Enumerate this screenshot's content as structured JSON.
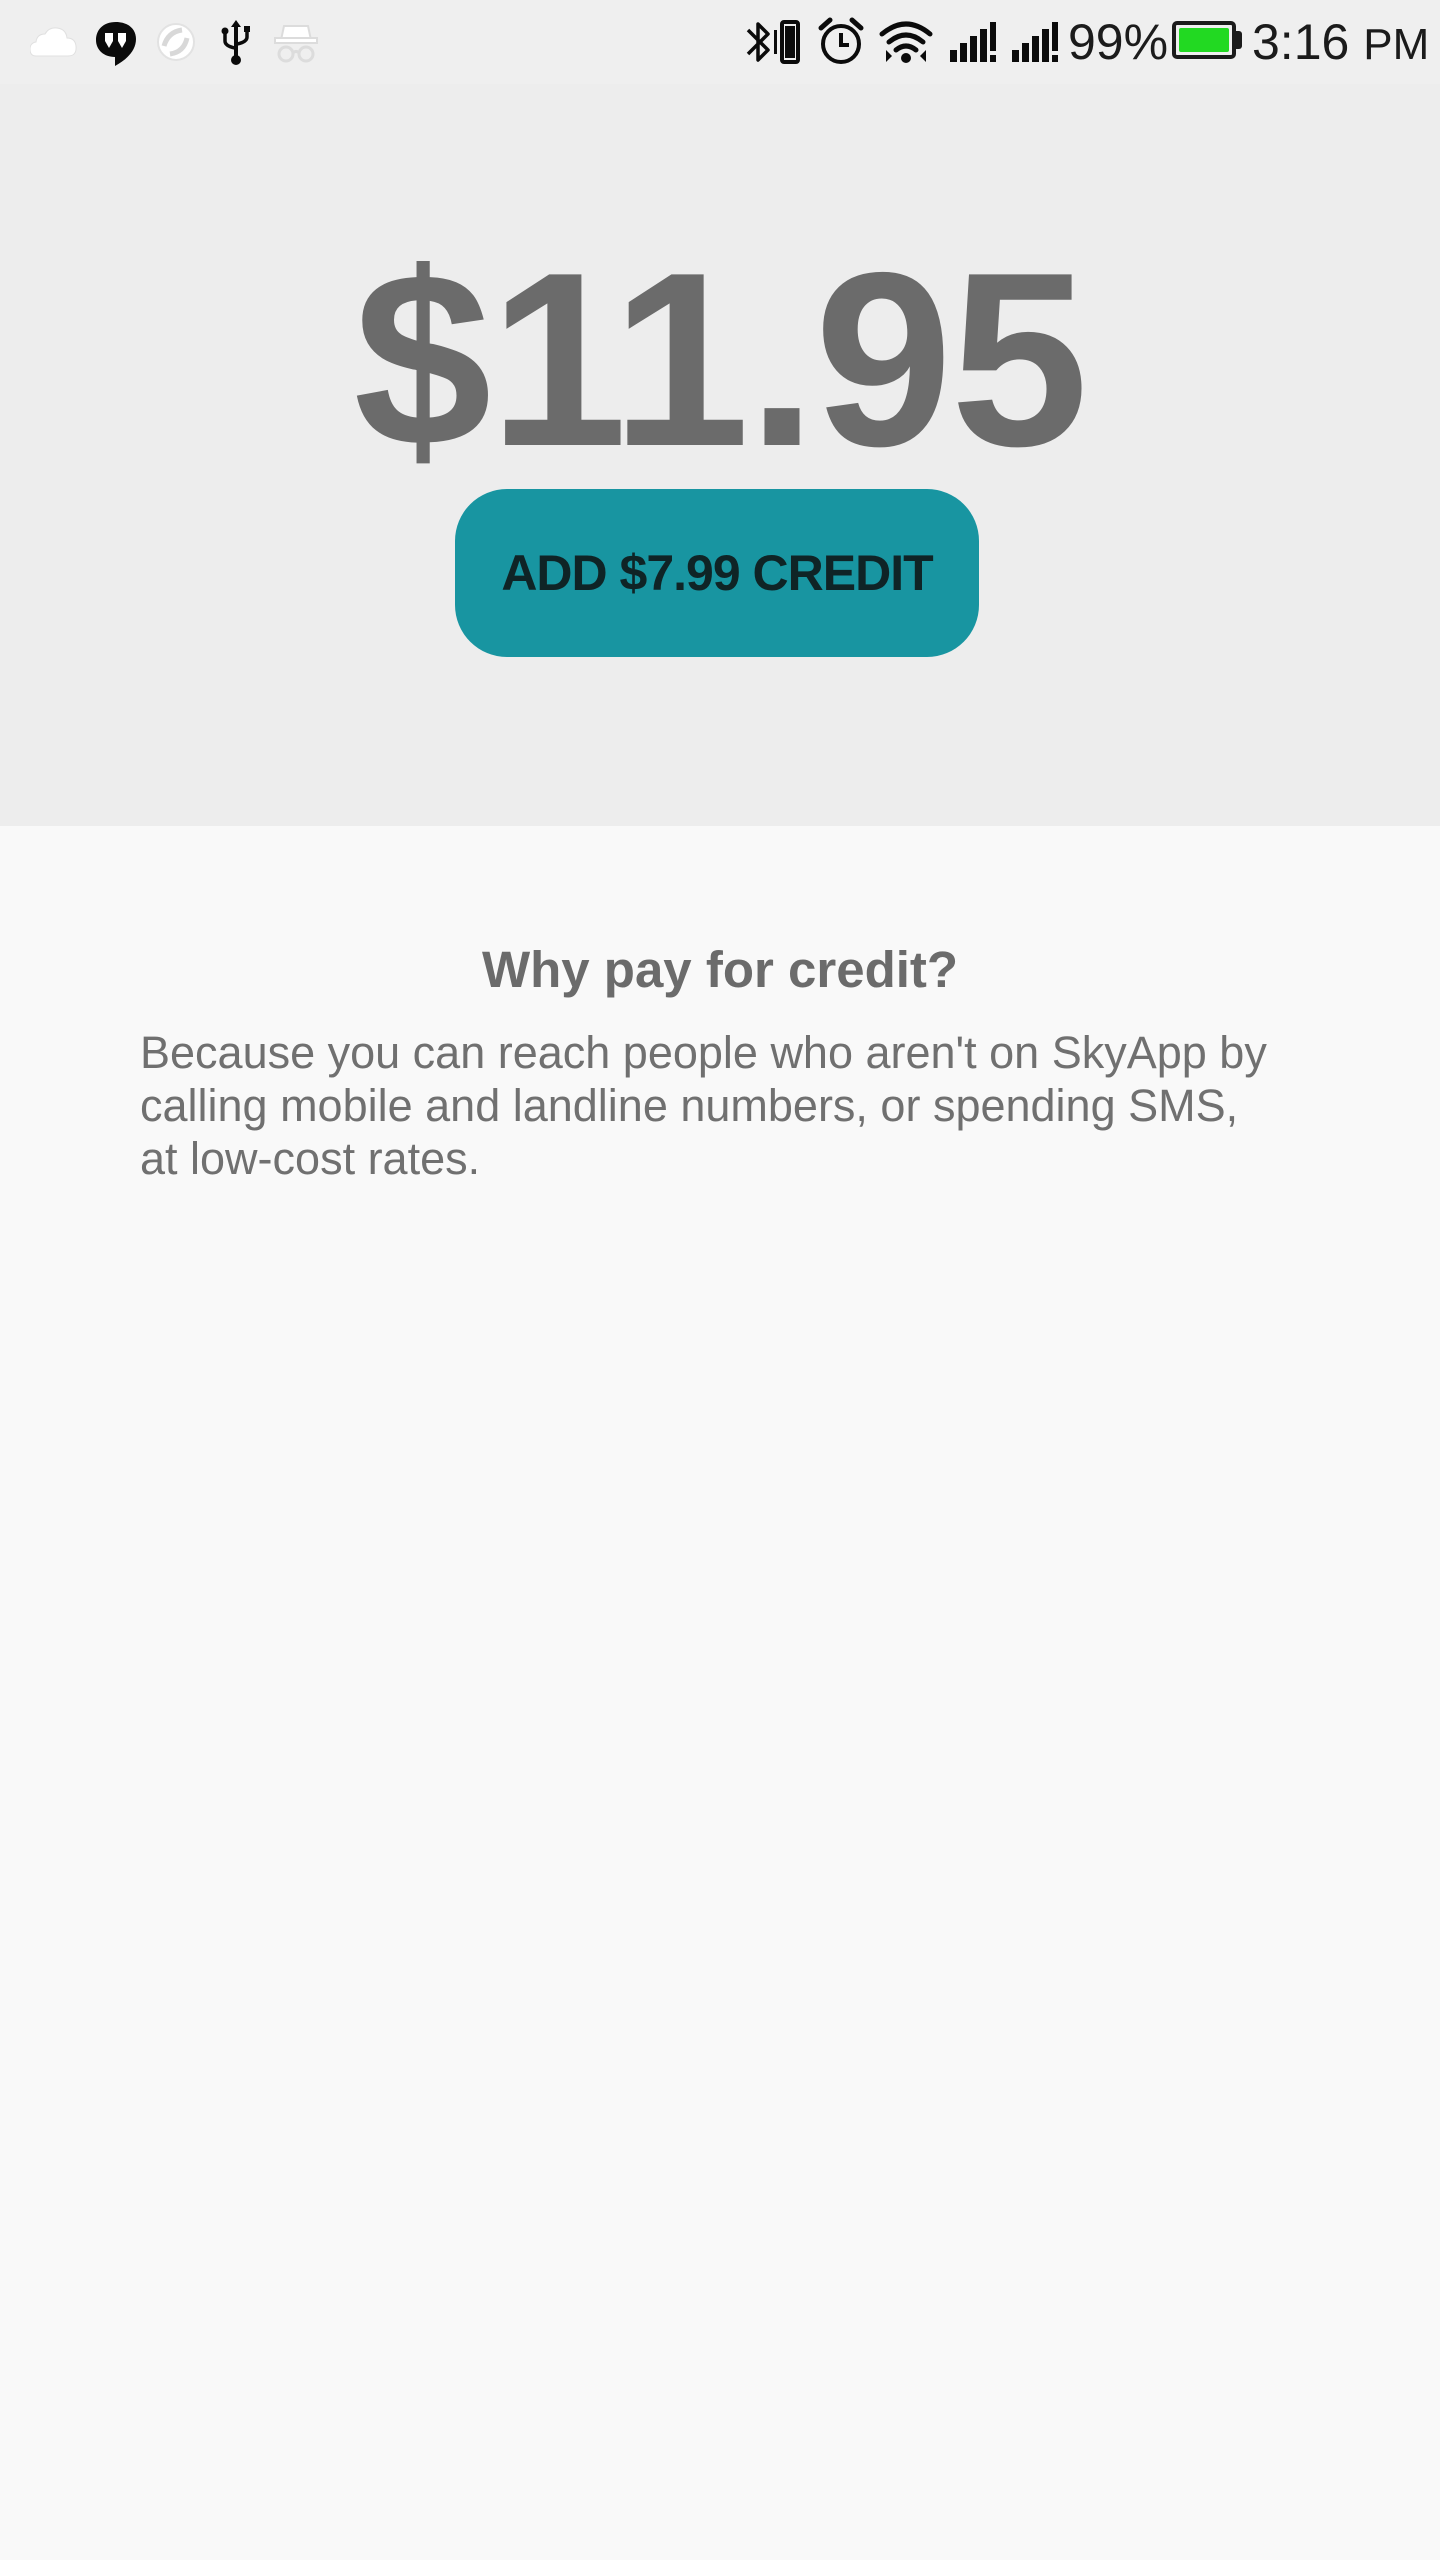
{
  "status_bar": {
    "left_icons": [
      "cloud-icon",
      "hangouts-icon",
      "sync-icon",
      "usb-icon",
      "incognito-icon"
    ],
    "right_icons": [
      "bluetooth-vibrate-icon",
      "alarm-icon",
      "wifi-icon",
      "signal-icon",
      "signal-icon"
    ],
    "battery_percent": "99%",
    "battery_level": 0.99,
    "battery_color": "#22d922",
    "time": "3:16",
    "time_suffix": "PM"
  },
  "balance": {
    "amount": "$11.95",
    "add_credit_label": "ADD $7.99 CREDIT",
    "button_color": "#1895a1"
  },
  "info": {
    "title": "Why pay for credit?",
    "body_lines": [
      "Because you can reach people who aren't on SkyApp by",
      "calling mobile and landline numbers, or spending SMS,",
      "at low-cost rates."
    ]
  }
}
